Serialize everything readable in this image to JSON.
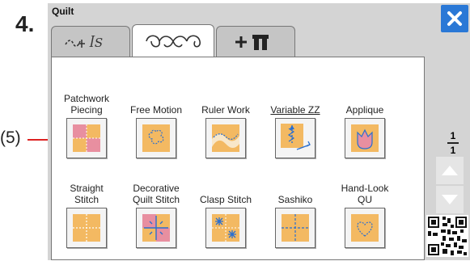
{
  "step_number": "4.",
  "callout_label": "(5)",
  "window": {
    "title": "Quilt"
  },
  "tabs": [
    {
      "name": "tab-quilt-text",
      "active": false
    },
    {
      "name": "tab-quilt-pattern",
      "active": true
    },
    {
      "name": "tab-quilt-tools",
      "active": false
    }
  ],
  "items": [
    {
      "label": "Patchwork\nPiecing"
    },
    {
      "label": "Free Motion"
    },
    {
      "label": "Ruler Work"
    },
    {
      "label": "Variable ZZ"
    },
    {
      "label": "Applique"
    },
    {
      "label": "Straight\nStitch"
    },
    {
      "label": "Decorative\nQuilt Stitch"
    },
    {
      "label": "Clasp Stitch"
    },
    {
      "label": "Sashiko"
    },
    {
      "label": "Hand-Look\nQU"
    }
  ],
  "pager": {
    "current": "1",
    "total": "1"
  },
  "colors": {
    "accent": "#2a78d6",
    "callout": "#d22222",
    "tile": "#f3b962",
    "pink": "#e88fa0"
  }
}
